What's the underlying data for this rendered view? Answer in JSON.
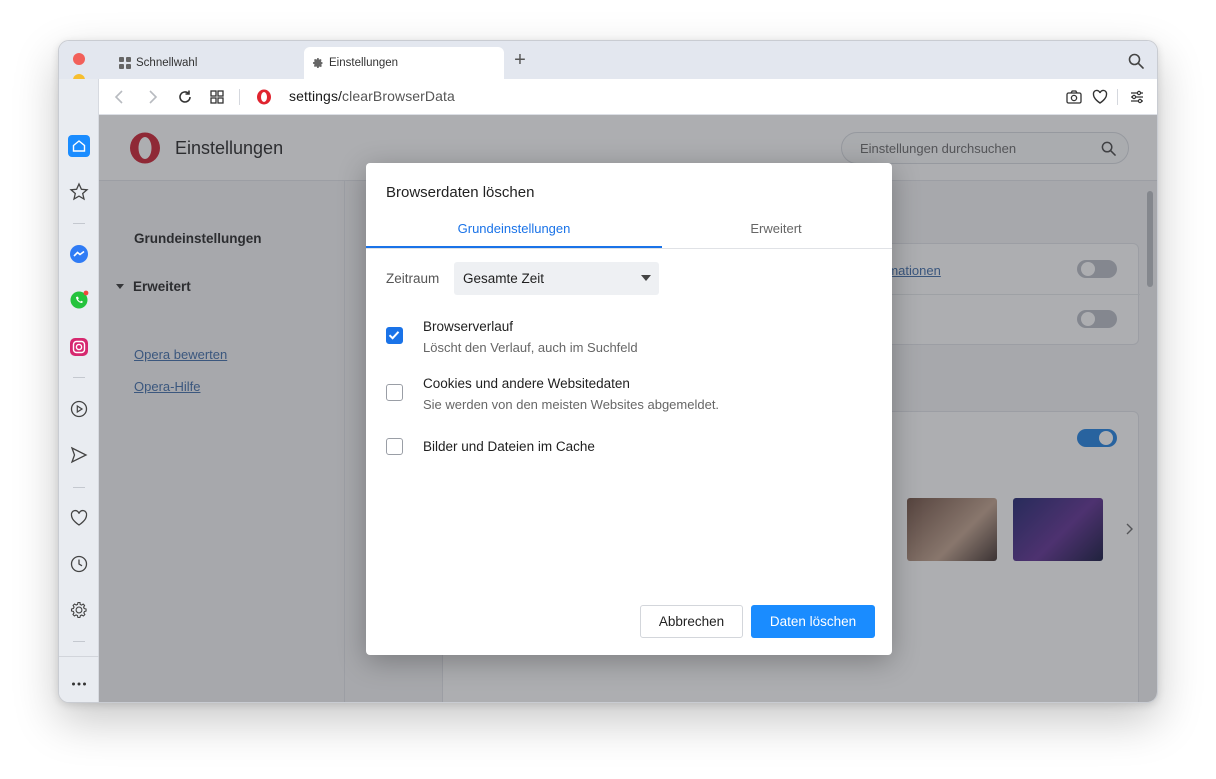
{
  "window": {
    "traffic_lights": {
      "close": "#f2605a",
      "minimize": "#f6be2f",
      "zoom": "#2ac840"
    }
  },
  "tabs": [
    {
      "label": "Schnellwahl",
      "icon": "speed-dial-grid-icon",
      "active": false
    },
    {
      "label": "Einstellungen",
      "icon": "gear-icon",
      "active": true
    }
  ],
  "addressbar": {
    "url_prefix": "settings/",
    "url_path": "clearBrowserData",
    "icons": [
      "back-icon",
      "forward-icon",
      "reload-icon",
      "tab-grid-icon",
      "opera-logo-icon",
      "camera-icon",
      "heart-icon",
      "easy-setup-icon"
    ]
  },
  "sidebar": {
    "items": [
      "home-icon",
      "star-icon",
      "messenger-icon",
      "whatsapp-icon",
      "instagram-icon",
      "player-icon",
      "send-icon",
      "heart-icon",
      "history-icon",
      "settings-icon",
      "more-icon"
    ]
  },
  "settings_page": {
    "title": "Einstellungen",
    "search_placeholder": "Einstellungen durchsuchen",
    "nav": {
      "basic": "Grundeinstellungen",
      "advanced": "Erweitert",
      "rate_link": "Opera bewerten",
      "help_link": "Opera-Hilfe"
    },
    "partial_link": "rmationen"
  },
  "dialog": {
    "title": "Browserdaten löschen",
    "tabs": [
      "Grundeinstellungen",
      "Erweitert"
    ],
    "active_tab": 0,
    "time_range": {
      "label": "Zeitraum",
      "value": "Gesamte Zeit"
    },
    "options": [
      {
        "title": "Browserverlauf",
        "subtitle": "Löscht den Verlauf, auch im Suchfeld",
        "checked": true
      },
      {
        "title": "Cookies und andere Websitedaten",
        "subtitle": "Sie werden von den meisten Websites abgemeldet.",
        "checked": false
      },
      {
        "title": "Bilder und Dateien im Cache",
        "subtitle": "",
        "checked": false
      }
    ],
    "buttons": {
      "cancel": "Abbrechen",
      "confirm": "Daten löschen"
    }
  },
  "colors": {
    "accent": "#1a73e8",
    "primary_button": "#1a8cff",
    "opera_red": "#cc1b2b"
  }
}
